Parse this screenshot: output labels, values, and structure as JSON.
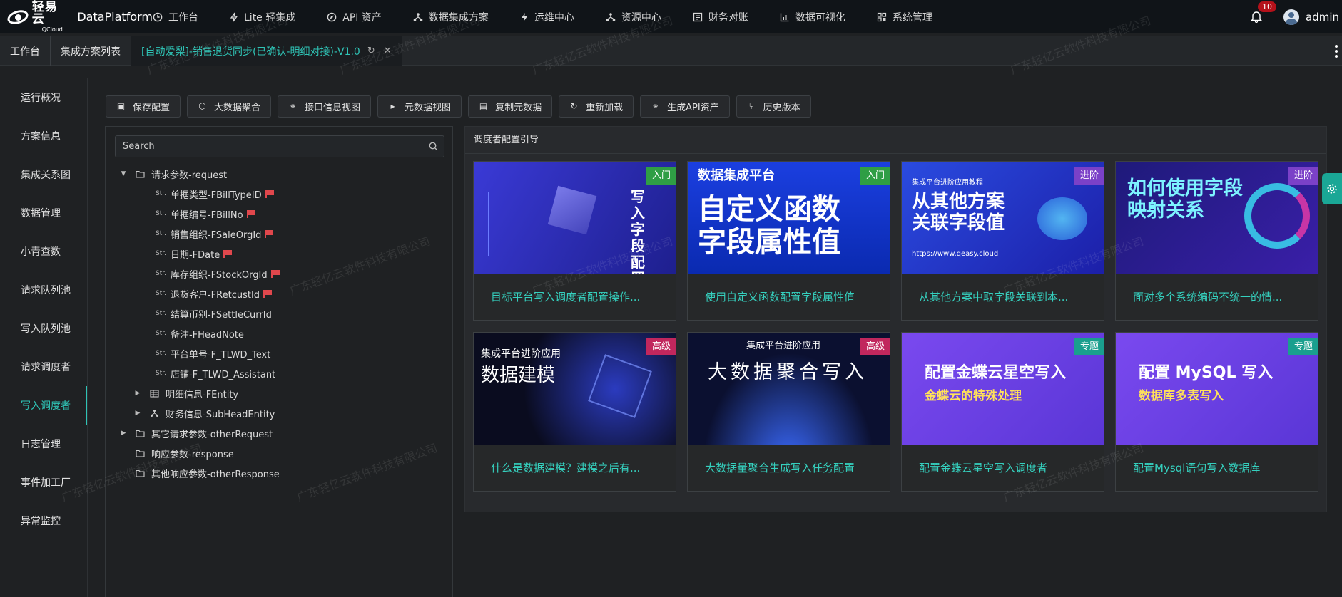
{
  "brand": {
    "name_cn": "轻易云",
    "name_en": "QCloud",
    "platform": "DataPlatform"
  },
  "nav": [
    {
      "label": "工作台",
      "icon": "clock-icon"
    },
    {
      "label": "Lite 轻集成",
      "icon": "lightning-icon"
    },
    {
      "label": "API 资产",
      "icon": "compass-icon"
    },
    {
      "label": "数据集成方案",
      "icon": "hierarchy-icon"
    },
    {
      "label": "运维中心",
      "icon": "bolt-icon"
    },
    {
      "label": "资源中心",
      "icon": "hierarchy-icon"
    },
    {
      "label": "财务对账",
      "icon": "ledger-icon"
    },
    {
      "label": "数据可视化",
      "icon": "chart-icon"
    },
    {
      "label": "系统管理",
      "icon": "grid-icon"
    }
  ],
  "user": {
    "notifications": "10",
    "name": "admin"
  },
  "tabs": [
    {
      "label": "工作台"
    },
    {
      "label": "集成方案列表"
    },
    {
      "label": "[自动爱梨]-销售退货同步(已确认-明细对接)-V1.0",
      "active": true
    }
  ],
  "sidebar": [
    "运行概况",
    "方案信息",
    "集成关系图",
    "数据管理",
    "小青查数",
    "请求队列池",
    "写入队列池",
    "请求调度者",
    "写入调度者",
    "日志管理",
    "事件加工厂",
    "异常监控"
  ],
  "sidebar_active_index": 8,
  "toolbar": [
    {
      "label": "保存配置",
      "icon": "save-icon"
    },
    {
      "label": "大数据聚合",
      "icon": "hexagon-icon"
    },
    {
      "label": "接口信息视图",
      "icon": "link-icon"
    },
    {
      "label": "元数据视图",
      "icon": "terminal-icon"
    },
    {
      "label": "复制元数据",
      "icon": "copy-icon"
    },
    {
      "label": "重新加载",
      "icon": "reload-icon"
    },
    {
      "label": "生成API资产",
      "icon": "link-icon"
    },
    {
      "label": "历史版本",
      "icon": "branch-icon"
    }
  ],
  "search": {
    "placeholder": "Search"
  },
  "tree": {
    "request": "请求参数-request",
    "str_tag": "Str.",
    "fields": [
      {
        "label": "单据类型-FBillTypeID",
        "flag": true
      },
      {
        "label": "单据编号-FBillNo",
        "flag": true
      },
      {
        "label": "销售组织-FSaleOrgId",
        "flag": true
      },
      {
        "label": "日期-FDate",
        "flag": true
      },
      {
        "label": "库存组织-FStockOrgId",
        "flag": true
      },
      {
        "label": "退货客户-FRetcustId",
        "flag": true
      },
      {
        "label": "结算币别-FSettleCurrId",
        "flag": false
      },
      {
        "label": "备注-FHeadNote",
        "flag": false
      },
      {
        "label": "平台单号-F_TLWD_Text",
        "flag": false
      },
      {
        "label": "店铺-F_TLWD_Assistant",
        "flag": false
      }
    ],
    "entity": "明细信息-FEntity",
    "sub_head": "财务信息-SubHeadEntity",
    "other_request": "其它请求参数-otherRequest",
    "response": "响应参数-response",
    "other_response": "其他响应参数-otherResponse"
  },
  "guide": {
    "title": "调度者配置引导",
    "cards": [
      {
        "tag": "入门",
        "tag_color": "#2f9e45",
        "caption": "目标平台写入调度者配置操作...",
        "thumb_text": "写入字段配置关联",
        "bg": "#2a2fb8"
      },
      {
        "tag": "入门",
        "tag_color": "#2f9e45",
        "caption": "使用自定义函数配置字段属性值",
        "thumb_small": "数据集成平台",
        "thumb_text": "自定义函数字段属性值",
        "bg": "#1446d8"
      },
      {
        "tag": "进阶",
        "tag_color": "#7b41c8",
        "caption": "从其他方案中取字段关联到本...",
        "thumb_small": "集成平台进阶应用教程",
        "thumb_text": "从其他方案关联字段值",
        "thumb_url": "https://www.qeasy.cloud",
        "bg": "#2238c8"
      },
      {
        "tag": "进阶",
        "tag_color": "#7b41c8",
        "caption": "面对多个系统编码不统一的情...",
        "thumb_text": "如何使用字段映射关系",
        "bg": "#2b1c8a"
      },
      {
        "tag": "高级",
        "tag_color": "#c1275d",
        "caption": "什么是数据建模？建模之后有...",
        "thumb_small": "集成平台进阶应用",
        "thumb_text": "数据建模",
        "bg": "#0c0f22"
      },
      {
        "tag": "高级",
        "tag_color": "#c1275d",
        "caption": "大数据量聚合生成写入任务配置",
        "thumb_small": "集成平台进阶应用",
        "thumb_text": "大数据聚合写入",
        "bg": "#0b1030"
      },
      {
        "tag": "专题",
        "tag_color": "#1a9f8e",
        "caption": "配置金蝶云星空写入调度者",
        "thumb_text": "配置金蝶云星空写入",
        "thumb_sub": "金蝶云的特殊处理",
        "bg": "#6a3fe0"
      },
      {
        "tag": "专题",
        "tag_color": "#1a9f8e",
        "caption": "配置Mysql语句写入数据库",
        "thumb_text": "配置 MySQL 写入",
        "thumb_sub": "数据库多表写入",
        "bg": "#6a3fe0"
      }
    ]
  },
  "watermark": "广东轻亿云软件科技有限公司"
}
